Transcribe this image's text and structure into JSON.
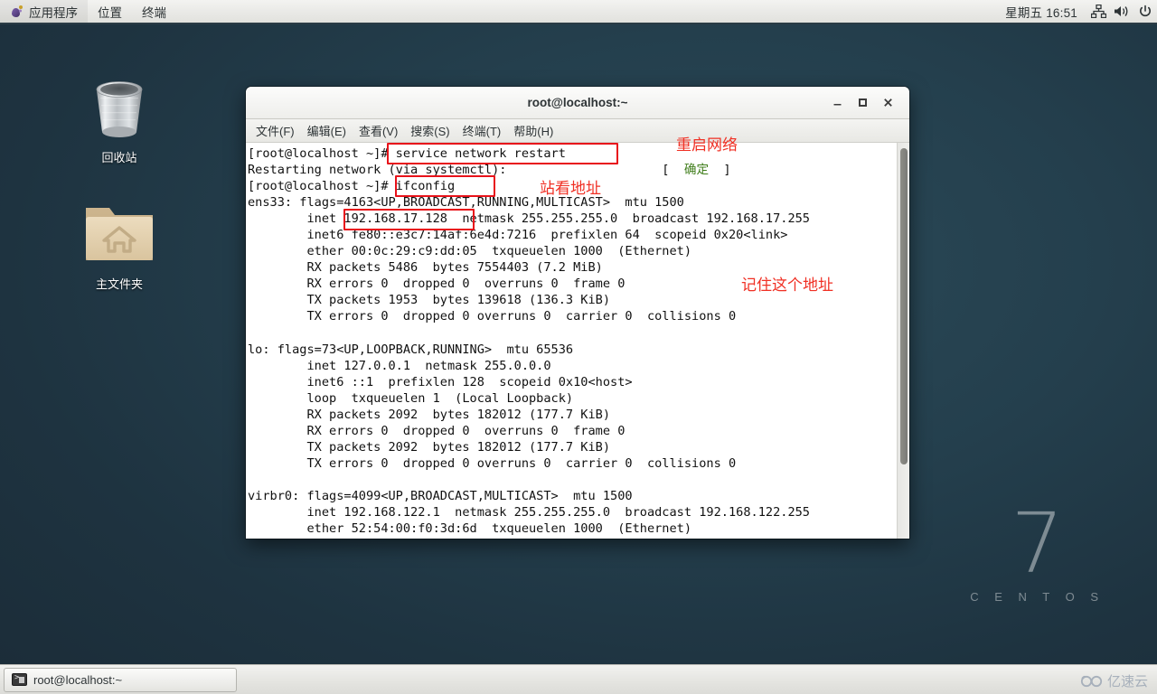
{
  "top_panel": {
    "menus": [
      {
        "name": "applications",
        "label": "应用程序",
        "icon": "gnome-foot-icon"
      },
      {
        "name": "places",
        "label": "位置"
      },
      {
        "name": "terminal",
        "label": "终端"
      }
    ],
    "clock": "星期五 16:51",
    "tray": [
      {
        "name": "network-icon"
      },
      {
        "name": "volume-icon"
      },
      {
        "name": "power-icon"
      }
    ]
  },
  "desktop": {
    "icons": [
      {
        "name": "trash-icon",
        "label": "回收站"
      },
      {
        "name": "home-folder-icon",
        "label": "主文件夹"
      }
    ],
    "brand": {
      "version": "7",
      "name": "C E N T O S"
    }
  },
  "terminal": {
    "title": "root@localhost:~",
    "window_buttons": {
      "minimize": "–",
      "maximize": "❐",
      "close": "✕"
    },
    "menu": [
      "文件(F)",
      "编辑(E)",
      "查看(V)",
      "搜索(S)",
      "终端(T)",
      "帮助(H)"
    ],
    "lines": [
      "[root@localhost ~]# service network restart",
      "Restarting network (via systemctl):                     [  确定  ]",
      "[root@localhost ~]# ifconfig",
      "ens33: flags=4163<UP,BROADCAST,RUNNING,MULTICAST>  mtu 1500",
      "        inet 192.168.17.128  netmask 255.255.255.0  broadcast 192.168.17.255",
      "        inet6 fe80::e3c7:14af:6e4d:7216  prefixlen 64  scopeid 0x20<link>",
      "        ether 00:0c:29:c9:dd:05  txqueuelen 1000  (Ethernet)",
      "        RX packets 5486  bytes 7554403 (7.2 MiB)",
      "        RX errors 0  dropped 0  overruns 0  frame 0",
      "        TX packets 1953  bytes 139618 (136.3 KiB)",
      "        TX errors 0  dropped 0 overruns 0  carrier 0  collisions 0",
      "",
      "lo: flags=73<UP,LOOPBACK,RUNNING>  mtu 65536",
      "        inet 127.0.0.1  netmask 255.0.0.0",
      "        inet6 ::1  prefixlen 128  scopeid 0x10<host>",
      "        loop  txqueuelen 1  (Local Loopback)",
      "        RX packets 2092  bytes 182012 (177.7 KiB)",
      "        RX errors 0  dropped 0  overruns 0  frame 0",
      "        TX packets 2092  bytes 182012 (177.7 KiB)",
      "        TX errors 0  dropped 0 overruns 0  carrier 0  collisions 0",
      "",
      "virbr0: flags=4099<UP,BROADCAST,MULTICAST>  mtu 1500",
      "        inet 192.168.122.1  netmask 255.255.255.0  broadcast 192.168.122.255",
      "        ether 52:54:00:f0:3d:6d  txqueuelen 1000  (Ethernet)"
    ],
    "ok_status": "确定"
  },
  "annotations": {
    "color": "#f03024",
    "labels": [
      {
        "name": "restart-network-note",
        "text": "重启网络"
      },
      {
        "name": "view-address-note",
        "text": "站看地址"
      },
      {
        "name": "remember-address-note",
        "text": "记住这个地址"
      }
    ],
    "boxes": [
      {
        "name": "service-network-restart-box"
      },
      {
        "name": "ifconfig-box"
      },
      {
        "name": "ip-address-box"
      }
    ]
  },
  "bottom_panel": {
    "task": {
      "name": "taskbar-terminal",
      "label": "root@localhost:~",
      "icon": "terminal-icon"
    },
    "watermark": "亿速云"
  }
}
